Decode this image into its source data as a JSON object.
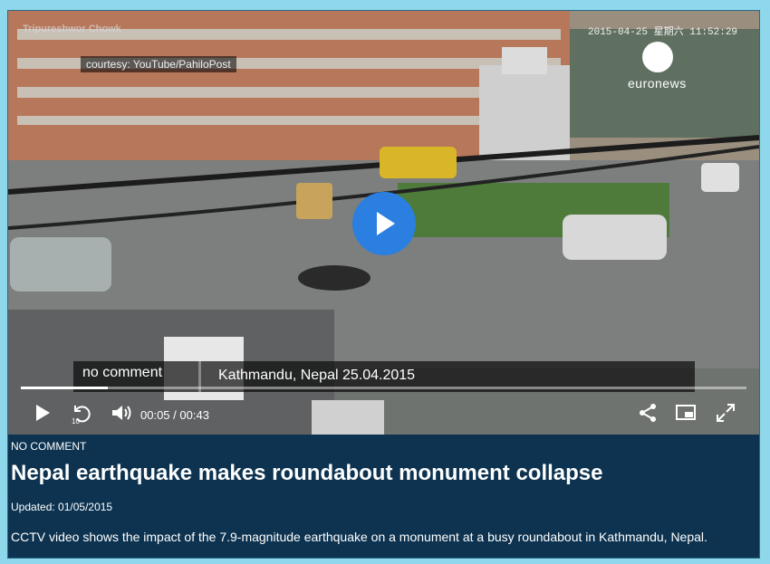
{
  "video": {
    "watermark_left": "Tripureshwor Chowk",
    "courtesy": "courtesy: YouTube/PahiloPost",
    "timestamp": "2015-04-25 星期六 11:52:29",
    "brand": "euronews",
    "lower_third": {
      "program": "no comment",
      "location": "Kathmandu, Nepal  25.04.2015"
    },
    "progress_fraction": 0.12,
    "current_time": "00:05",
    "time_separator": "/",
    "duration": "00:43",
    "rewind_seconds": "10"
  },
  "article": {
    "category": "NO COMMENT",
    "title": "Nepal earthquake makes roundabout monument collapse",
    "updated": "Updated: 01/05/2015",
    "description": "CCTV video shows the impact of the 7.9-magnitude earthquake on a monument at a busy roundabout in Kathmandu, Nepal."
  },
  "colors": {
    "page_bg": "#8fd7ea",
    "panel_bg": "#0d3350",
    "play_button": "#2a7fe0"
  },
  "icons": {
    "play": "play-icon",
    "rewind": "rewind-10-icon",
    "volume": "volume-icon",
    "share": "share-icon",
    "pip": "picture-in-picture-icon",
    "fullscreen": "fullscreen-icon"
  }
}
